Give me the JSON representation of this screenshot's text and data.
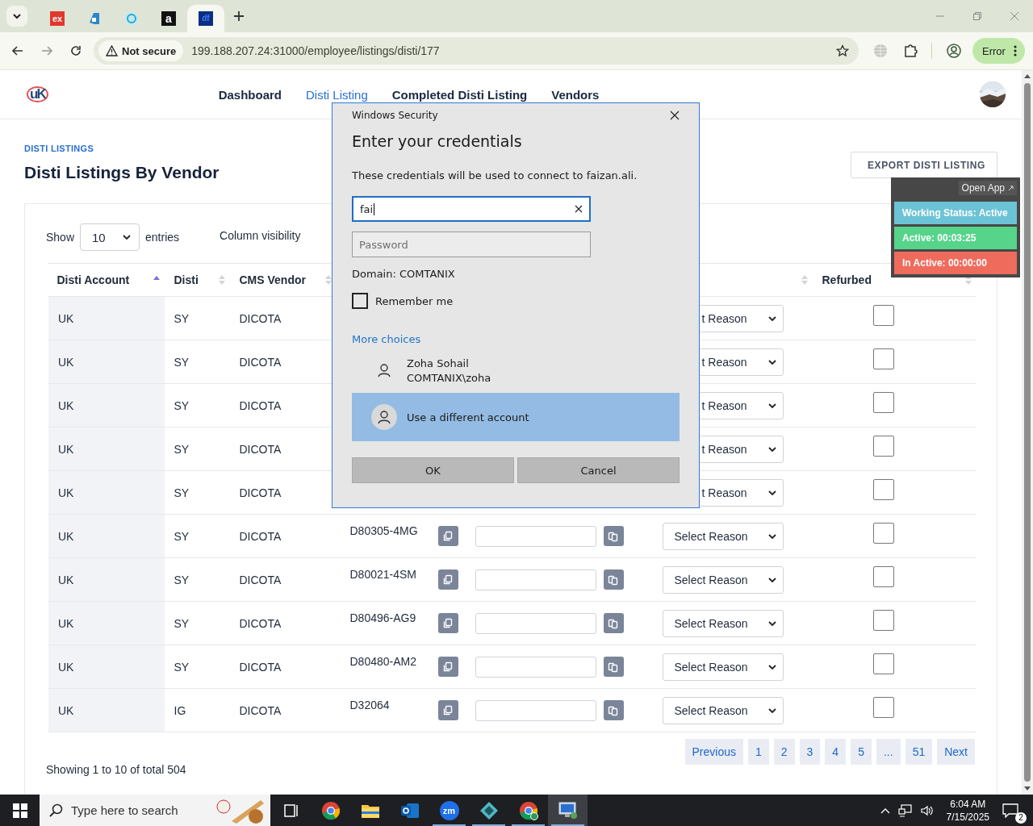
{
  "browser": {
    "tabs": [
      {
        "kind": "ex",
        "label": "ex",
        "selected": false
      },
      {
        "kind": "drop",
        "selected": false
      },
      {
        "kind": "ring",
        "selected": false
      },
      {
        "kind": "amazon",
        "label": "a",
        "selected": false
      },
      {
        "kind": "df",
        "label": "df",
        "selected": true
      }
    ],
    "security": "Not secure",
    "url": "199.188.207.24:31000/employee/listings/disti/177",
    "profile_button": "Error"
  },
  "nav": {
    "logo": "uK",
    "links": [
      {
        "label": "Dashboard",
        "selected": false
      },
      {
        "label": "Disti Listing",
        "selected": true
      },
      {
        "label": "Completed Disti Listing",
        "selected": false
      },
      {
        "label": "Vendors",
        "selected": false
      }
    ]
  },
  "page": {
    "breadcrumb": "DISTI LISTINGS",
    "title": "Disti Listings By Vendor",
    "export_button": "EXPORT DISTI LISTING"
  },
  "table_controls": {
    "show_label": "Show",
    "page_size": "10",
    "entries_label": "entries",
    "column_visibility": "Column visibility"
  },
  "table": {
    "columns": [
      {
        "label": "Disti Account",
        "sorted": true
      },
      {
        "label": "Disti",
        "sorted": false
      },
      {
        "label": "CMS Vendor",
        "sorted": false
      },
      {
        "label": "Refurbed",
        "sorted": false
      }
    ],
    "rows": [
      {
        "disti_account": "UK",
        "disti": "SY",
        "cms_vendor": "DICOTA",
        "reason": "t Reason",
        "refurbed": false
      },
      {
        "disti_account": "UK",
        "disti": "SY",
        "cms_vendor": "DICOTA",
        "reason": "t Reason",
        "refurbed": false
      },
      {
        "disti_account": "UK",
        "disti": "SY",
        "cms_vendor": "DICOTA",
        "reason": "t Reason",
        "refurbed": false
      },
      {
        "disti_account": "UK",
        "disti": "SY",
        "cms_vendor": "DICOTA",
        "reason": "t Reason",
        "refurbed": false
      },
      {
        "disti_account": "UK",
        "disti": "SY",
        "cms_vendor": "DICOTA",
        "reason": "t Reason",
        "refurbed": false
      },
      {
        "disti_account": "UK",
        "disti": "SY",
        "cms_vendor": "DICOTA",
        "part_number": "D80305-4MG",
        "reason": "Select Reason",
        "refurbed": false
      },
      {
        "disti_account": "UK",
        "disti": "SY",
        "cms_vendor": "DICOTA",
        "part_number": "D80021-4SM",
        "reason": "Select Reason",
        "refurbed": false
      },
      {
        "disti_account": "UK",
        "disti": "SY",
        "cms_vendor": "DICOTA",
        "part_number": "D80496-AG9",
        "reason": "Select Reason",
        "refurbed": false
      },
      {
        "disti_account": "UK",
        "disti": "SY",
        "cms_vendor": "DICOTA",
        "part_number": "D80480-AM2",
        "reason": "Select Reason",
        "refurbed": false
      },
      {
        "disti_account": "UK",
        "disti": "IG",
        "cms_vendor": "DICOTA",
        "part_number": "D32064",
        "reason": "Select Reason",
        "refurbed": false
      }
    ]
  },
  "pagination": {
    "summary": "Showing 1 to 10 of total 504",
    "previous": "Previous",
    "pages": [
      "1",
      "2",
      "3",
      "4",
      "5",
      "...",
      "51"
    ],
    "next": "Next"
  },
  "tracker": {
    "open_app": "Open App",
    "items": [
      {
        "label": "Working Status: Active",
        "color": "#6cc3d5"
      },
      {
        "label": "Active: 00:03:25",
        "color": "#56d48a"
      },
      {
        "label": "In Active: 00:00:00",
        "color": "#ef6b5c"
      }
    ]
  },
  "dialog": {
    "app": "Windows Security",
    "title": "Enter your credentials",
    "message": "These credentials will be used to connect to faizan.ali.",
    "username": "fai",
    "password_placeholder": "Password",
    "domain": "Domain: COMTANIX",
    "remember": {
      "label": "Remember me",
      "checked": false
    },
    "more_choices": "More choices",
    "accounts": [
      {
        "name": "Zoha Sohail",
        "detail": "COMTANIX\\zoha",
        "selected": false
      },
      {
        "name": "Use a different account",
        "selected": true
      }
    ],
    "buttons": [
      "OK",
      "Cancel"
    ]
  },
  "taskbar": {
    "search_placeholder": "Type here to search",
    "apps": [
      {
        "kind": "taskview",
        "running": false,
        "selected": false
      },
      {
        "kind": "chrome",
        "running": false,
        "selected": false
      },
      {
        "kind": "folder",
        "running": false,
        "selected": false
      },
      {
        "kind": "outlook",
        "running": false,
        "selected": false
      },
      {
        "kind": "zoom",
        "label": "zm",
        "running": true,
        "selected": false
      },
      {
        "kind": "diamond",
        "running": true,
        "selected": false
      },
      {
        "kind": "chrome",
        "running": true,
        "selected": false
      },
      {
        "kind": "remote",
        "running": true,
        "selected": true
      }
    ],
    "time": "6:04 AM",
    "date": "7/15/2025",
    "notifications": "2"
  }
}
